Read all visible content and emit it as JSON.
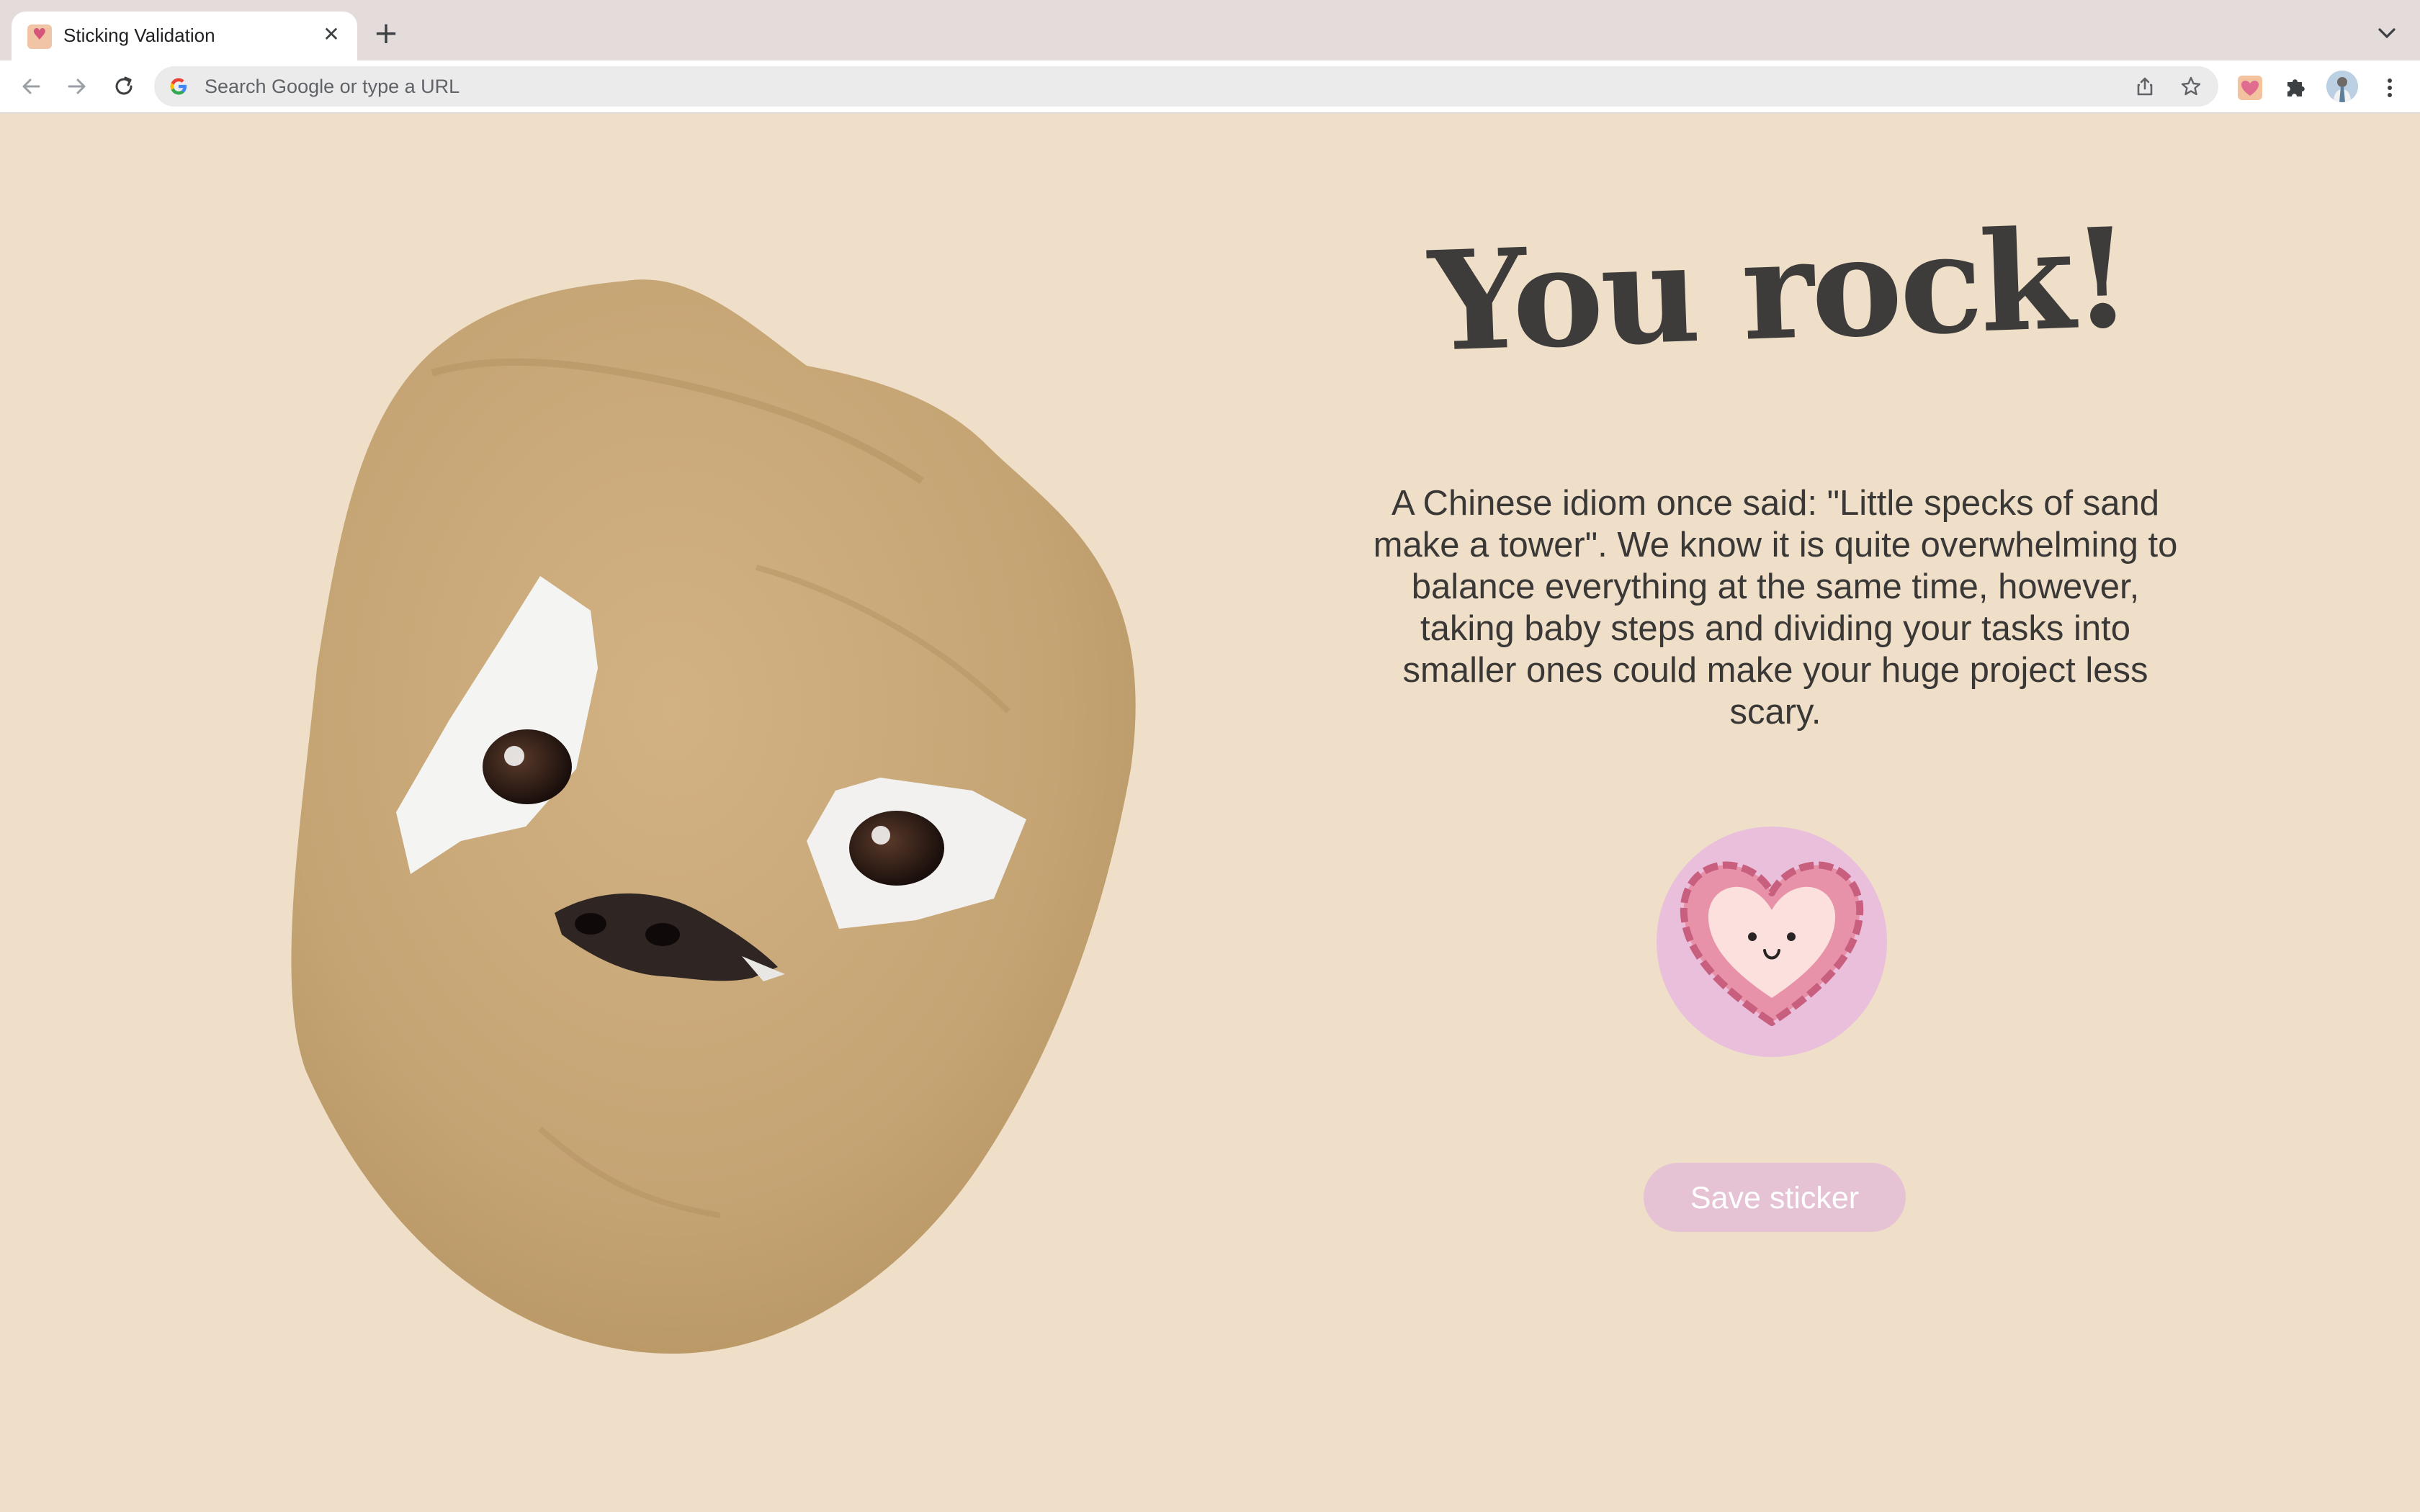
{
  "browser": {
    "tab": {
      "title": "Sticking Validation",
      "close_glyph": "✕"
    },
    "new_tab_glyph": "+",
    "omnibox": {
      "placeholder": "Search Google or type a URL"
    },
    "icons": {
      "back": "back-arrow-icon",
      "forward": "forward-arrow-icon",
      "reload": "reload-icon",
      "share": "share-icon",
      "bookmark": "star-icon",
      "extension_sticker": "heart-sticker-extension-icon",
      "extensions": "puzzle-icon",
      "profile": "avatar",
      "menu": "kebab-menu-icon",
      "tab_list": "chevron-down-icon"
    }
  },
  "main": {
    "headline": "You rock!",
    "message": "A Chinese idiom once said: \"Little specks of sand make a tower\". We know it is quite overwhelming to balance everything at the same time, however, taking baby steps and dividing your tasks into smaller ones could make your huge project less scary.",
    "save_label": "Save sticker",
    "sticker_icon": "smiling-heart-sticker-icon"
  },
  "colors": {
    "page_background": "#efdfc8",
    "text": "#3e3c3b",
    "sticker_circle": "#e9bfdc",
    "button": "#e6c2d5"
  }
}
